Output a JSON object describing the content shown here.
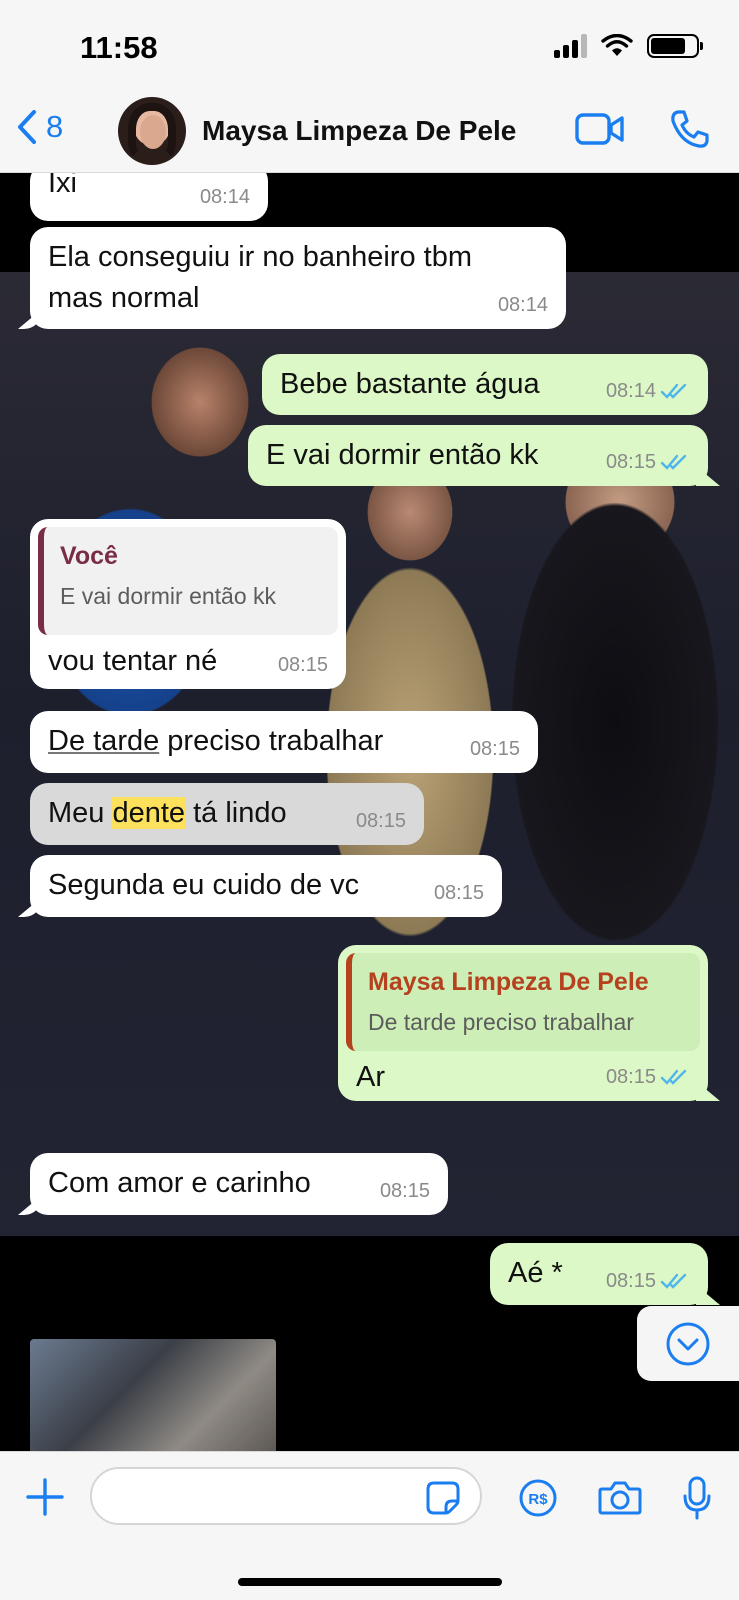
{
  "status": {
    "time": "11:58"
  },
  "header": {
    "back_count": "8",
    "contact_name": "Maysa Limpeza De Pele"
  },
  "messages": [
    {
      "dir": "in",
      "text": "Ixi",
      "time": "08:14"
    },
    {
      "dir": "in",
      "text_line1": "Ela conseguiu ir no banheiro tbm",
      "text_line2": "mas normal",
      "time": "08:14"
    },
    {
      "dir": "out",
      "text": "Bebe bastante água",
      "time": "08:14"
    },
    {
      "dir": "out",
      "text": "E vai dormir então kk",
      "time": "08:15"
    },
    {
      "dir": "in",
      "reply_name": "Você",
      "reply_text": "E vai dormir então kk",
      "text": "vou tentar né",
      "time": "08:15"
    },
    {
      "dir": "in",
      "text_part1": "De tarde",
      "text_part2": " preciso trabalhar",
      "time": "08:15"
    },
    {
      "dir": "in",
      "text_part1": "Meu ",
      "text_part2": "dente",
      "text_part3": " tá lindo",
      "time": "08:15"
    },
    {
      "dir": "in",
      "text": "Segunda eu cuido de vc",
      "time": "08:15"
    },
    {
      "dir": "out",
      "reply_name": "Maysa Limpeza De Pele",
      "reply_text": "De tarde preciso trabalhar",
      "text": "Ar",
      "time": "08:15"
    },
    {
      "dir": "in",
      "text": "Com amor e carinho",
      "time": "08:15"
    },
    {
      "dir": "out",
      "text": "Aé *",
      "time": "08:15"
    }
  ],
  "colors": {
    "accent": "#1a7ef0",
    "outgoing": "#dcf8c6",
    "incoming": "#ffffff",
    "read_ticks": "#4fb6ec",
    "reply_you": "#7a2e45",
    "reply_contact": "#b5411e"
  }
}
